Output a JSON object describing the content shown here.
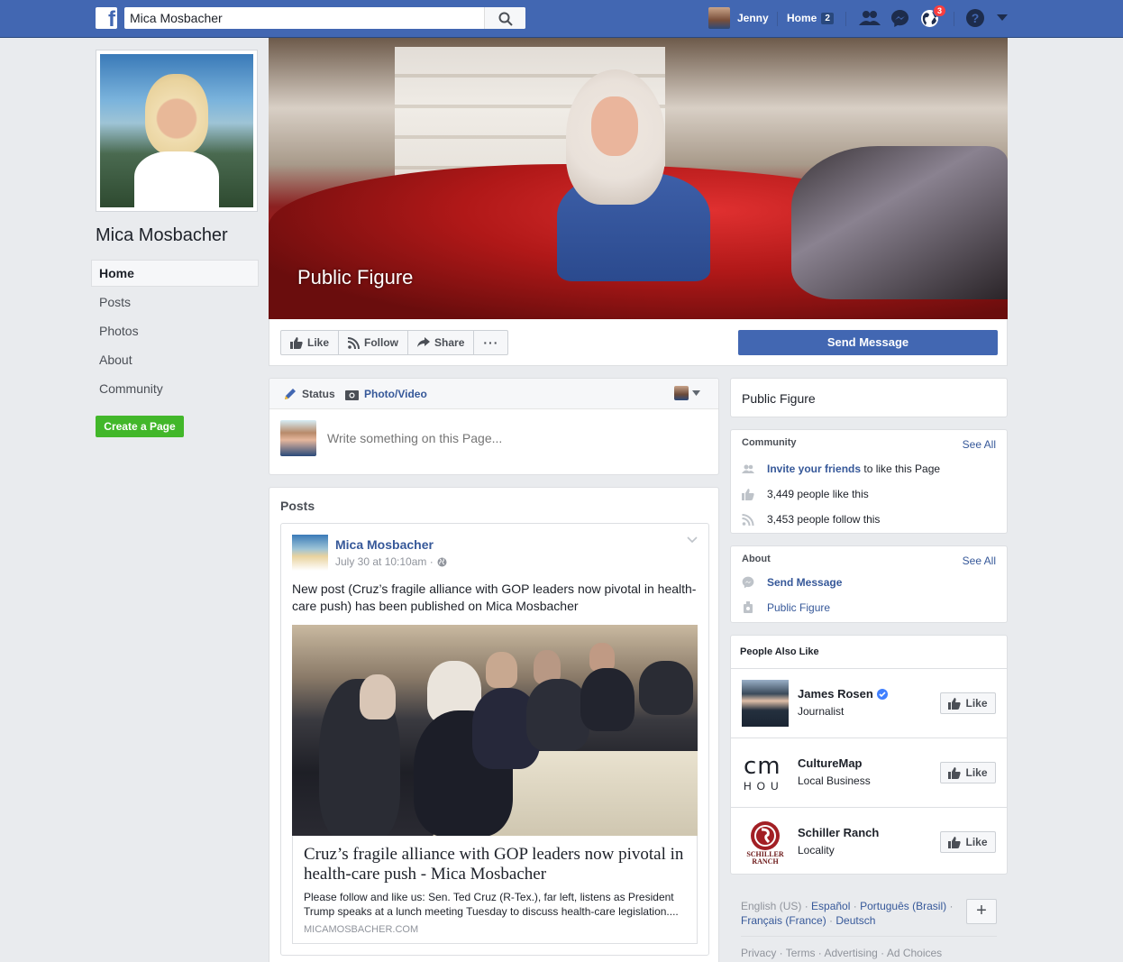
{
  "topbar": {
    "search_value": "Mica Mosbacher",
    "user_name": "Jenny",
    "home_label": "Home",
    "home_count": "2",
    "notifications_count": "3",
    "logo_letter": "f"
  },
  "left": {
    "page_name": "Mica Mosbacher",
    "nav": [
      "Home",
      "Posts",
      "Photos",
      "About",
      "Community"
    ],
    "create_page": "Create a Page"
  },
  "cover": {
    "title": "Public Figure"
  },
  "actions": {
    "like": "Like",
    "follow": "Follow",
    "share": "Share",
    "more": "···",
    "send_message": "Send Message"
  },
  "composer": {
    "status": "Status",
    "photo_video": "Photo/Video",
    "placeholder": "Write something on this Page..."
  },
  "posts": {
    "title": "Posts",
    "author": "Mica Mosbacher",
    "time": "July 30 at 10:10am ·",
    "text": "New post (Cruz’s fragile alliance with GOP leaders now pivotal in health-care push) has been published on Mica Mosbacher",
    "link_title": "Cruz’s fragile alliance with GOP leaders now pivotal in health-care push - Mica Mosbacher",
    "link_desc": "Please follow and like us: Sen. Ted Cruz (R-Tex.), far left, listens as President Trump speaks at a lunch meeting Tuesday to discuss health-care legislation....",
    "link_domain": "MICAMOSBACHER.COM"
  },
  "right": {
    "category": "Public Figure",
    "community": {
      "title": "Community",
      "see_all": "See All",
      "invite_link": "Invite your friends",
      "invite_rest": " to like this Page",
      "likes": "3,449 people like this",
      "follows": "3,453 people follow this"
    },
    "about": {
      "title": "About",
      "see_all": "See All",
      "send_message": "Send Message",
      "category": "Public Figure"
    },
    "people_also_like": {
      "title": "People Also Like",
      "like_label": "Like",
      "items": [
        {
          "name": "James Rosen",
          "category": "Journalist"
        },
        {
          "name": "CultureMap",
          "category": "Local Business"
        },
        {
          "name": "Schiller Ranch",
          "category": "Locality"
        }
      ],
      "culturemap_logo_top": "cm",
      "culturemap_logo_bottom": "HOU",
      "schiller_logo_text": "SCHILLER RANCH"
    },
    "languages": {
      "current": "English (US)",
      "others": [
        "Español",
        "Português (Brasil)",
        "Français (France)",
        "Deutsch"
      ],
      "plus": "+"
    },
    "footer": "Privacy · Terms · Advertising · Ad Choices"
  },
  "colors": {
    "topbar": "#4267b2",
    "link": "#365899",
    "create_page": "#42b72a",
    "badge": "#fa3e3e"
  }
}
